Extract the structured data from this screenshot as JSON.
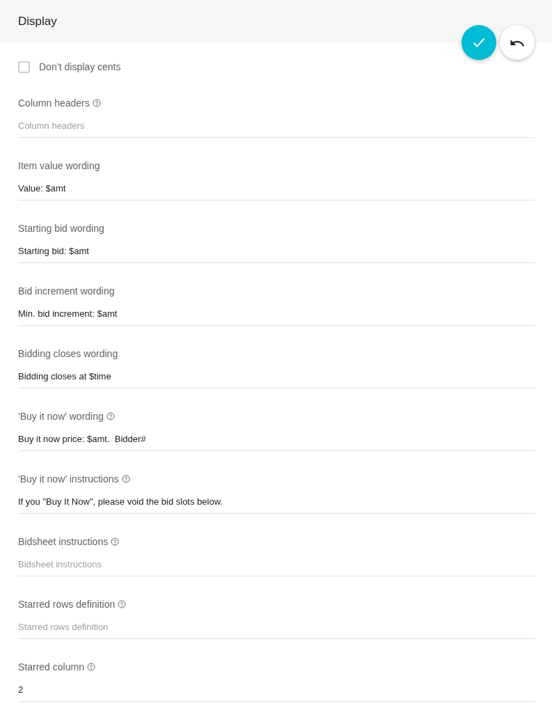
{
  "header": {
    "title": "Display"
  },
  "checkbox": {
    "label": "Don’t display cents",
    "checked": false
  },
  "fields": [
    {
      "label": "Column headers",
      "help": true,
      "placeholder": "Column headers"
    },
    {
      "label": "Item value wording",
      "help": false,
      "value": "Value: $amt"
    },
    {
      "label": "Starting bid wording",
      "help": false,
      "value": "Starting bid: $amt"
    },
    {
      "label": "Bid increment wording",
      "help": false,
      "value": "Min. bid increment: $amt"
    },
    {
      "label": "Bidding closes wording",
      "help": false,
      "value": "Bidding closes at $time"
    },
    {
      "label": "'Buy it now’ wording",
      "help": true,
      "value": "Buy it now price: $amt.  Bidder#"
    },
    {
      "label": "'Buy it now’ instructions",
      "help": true,
      "value": "If you \"Buy It Now\", please void the bid slots below."
    },
    {
      "label": "Bidsheet instructions",
      "help": true,
      "placeholder": "Bidsheet instructions"
    },
    {
      "label": "Starred rows definition",
      "help": true,
      "placeholder": "Starred rows definition"
    },
    {
      "label": "Starred column",
      "help": true,
      "value": "2"
    }
  ]
}
